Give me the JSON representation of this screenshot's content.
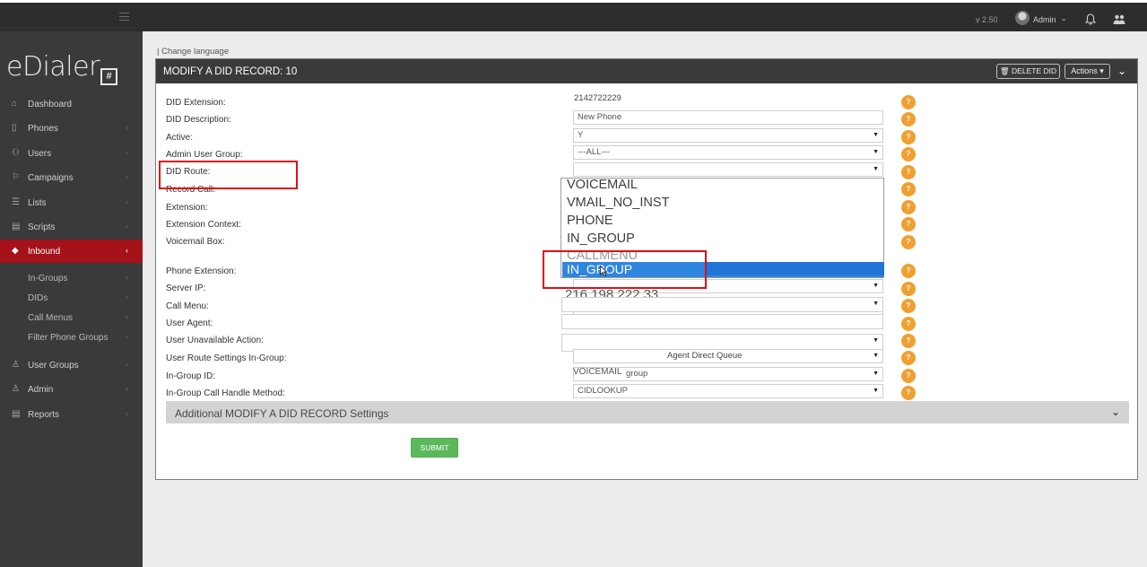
{
  "topbar": {
    "version": "v 2.50",
    "admin_name": "Admin",
    "admin_caret": "⌄"
  },
  "sidebar": {
    "logo_text": "eDialer",
    "logo_badge": "#",
    "items": [
      {
        "label": "Dashboard",
        "icon": "home-icon"
      },
      {
        "label": "Phones",
        "icon": "phone-icon"
      },
      {
        "label": "Users",
        "icon": "users-icon"
      },
      {
        "label": "Campaigns",
        "icon": "flag-icon"
      },
      {
        "label": "Lists",
        "icon": "list-icon"
      },
      {
        "label": "Scripts",
        "icon": "script-icon"
      },
      {
        "label": "Inbound",
        "icon": "diamond-icon"
      },
      {
        "label": "User Groups",
        "icon": "user-icon"
      },
      {
        "label": "Admin",
        "icon": "user-icon"
      },
      {
        "label": "Reports",
        "icon": "report-icon"
      }
    ],
    "subitems": [
      "In-Groups",
      "DIDs",
      "Call Menus",
      "Filter Phone Groups"
    ]
  },
  "page": {
    "change_language": "| Change language",
    "panel_title": "MODIFY A DID RECORD: 10",
    "delete_button": "DELETE DID",
    "actions_button": "Actions ▾"
  },
  "form": {
    "labels": {
      "did_extension": "DID Extension:",
      "did_description": "DID Description:",
      "active": "Active:",
      "admin_user_group": "Admin User Group:",
      "did_route": "DID Route:",
      "record_call": "Record Call:",
      "extension": "Extension:",
      "extension_context": "Extension Context:",
      "voicemail_box": "Voicemail Box:",
      "phone_extension": "Phone Extension:",
      "server_ip": "Server IP:",
      "call_menu": "Call Menu:",
      "user_agent": "User Agent:",
      "user_unavailable_action": "User Unavailable Action:",
      "user_route_settings": "User Route Settings In-Group:",
      "in_group_id": "In-Group ID:",
      "in_group_call_handle": "In-Group Call Handle Method:"
    },
    "values": {
      "did_extension": "2142722229",
      "did_description": "New Phone",
      "active": "Y",
      "admin_user_group": "---ALL---",
      "server_ip": "216.198.222.33",
      "user_route_settings": "Agent Direct Queue",
      "in_group_id": "group",
      "in_group_id_overlap": "VOICEMAIL",
      "in_group_call_handle": "CIDLOOKUP"
    },
    "help_glyph": "?",
    "route_dropdown": {
      "options": [
        "VOICEMAIL",
        "VMAIL_NO_INST",
        "PHONE",
        "IN_GROUP",
        "CALLMENU"
      ],
      "selected": "IN_GROUP"
    },
    "additional_settings": "Additional MODIFY A DID RECORD Settings",
    "submit": "SUBMIT"
  }
}
